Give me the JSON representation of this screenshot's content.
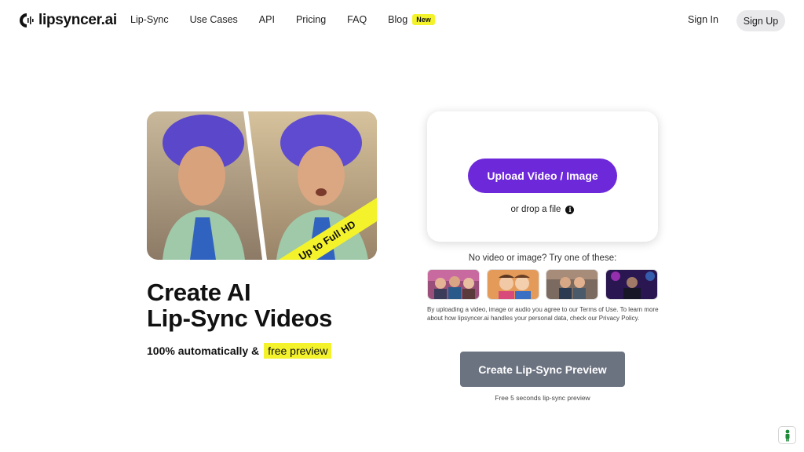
{
  "brand": {
    "name": "lipsyncer.ai"
  },
  "nav": {
    "links": [
      "Lip-Sync",
      "Use Cases",
      "API",
      "Pricing",
      "FAQ",
      "Blog"
    ],
    "blog_badge": "New",
    "signin": "Sign In",
    "signup": "Sign Up"
  },
  "hero": {
    "image_banner": "Up to Full HD",
    "headline_line1": "Create AI",
    "headline_line2": "Lip-Sync Videos",
    "subline": "100% automatically &",
    "highlight": "free preview"
  },
  "upload": {
    "button": "Upload Video / Image",
    "drop_text": "or drop a file",
    "info_icon": "i"
  },
  "samples": {
    "label": "No video or image? Try one of these:",
    "count": 4
  },
  "terms": "By uploading a video, image or audio you agree to our Terms of Use. To learn more about how lipsyncer.ai handles your personal data, check our Privacy Policy.",
  "cta": {
    "button": "Create Lip-Sync Preview",
    "note": "Free 5 seconds lip-sync preview"
  },
  "colors": {
    "accent_purple": "#6d28d9",
    "highlight_yellow": "#f4f32b",
    "cta_gray": "#6b7280"
  },
  "icons": {
    "logo": "sound-wave-logo-icon",
    "info": "info-icon",
    "help": "person-help-icon"
  }
}
